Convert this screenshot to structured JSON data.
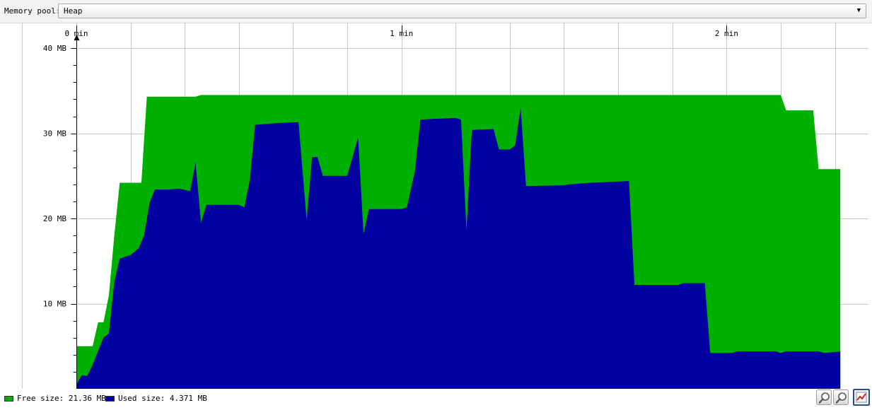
{
  "toolbar": {
    "pool_label": "Memory pool:",
    "pool_value": "Heap"
  },
  "colors": {
    "free": "#00b000",
    "used": "#0000a0"
  },
  "legend": {
    "free": "Free size: 21.36 MB",
    "used": "Used size: 4.371 MB"
  },
  "icons": [
    "zoom-in-icon",
    "zoom-out-icon",
    "chart-settings-icon"
  ],
  "chart_data": {
    "type": "area",
    "x_unit": "seconds",
    "x_ticks": [
      {
        "value": 0,
        "label": "0 min"
      },
      {
        "value": 60,
        "label": "1 min"
      },
      {
        "value": 120,
        "label": "2 min"
      }
    ],
    "y_ticks": [
      {
        "value": 10,
        "label": "10 MB"
      },
      {
        "value": 20,
        "label": "20 MB"
      },
      {
        "value": 30,
        "label": "30 MB"
      },
      {
        "value": 40,
        "label": "40 MB"
      }
    ],
    "xlim": [
      -14.1,
      146.2
    ],
    "ylim": [
      0,
      43
    ],
    "grid": true,
    "legend_position": "bottom-left",
    "series": [
      {
        "name": "Free size",
        "color_key": "free",
        "points": [
          [
            0,
            5
          ],
          [
            3,
            5
          ],
          [
            4,
            7.8
          ],
          [
            5,
            7.8
          ],
          [
            6,
            11
          ],
          [
            7,
            18
          ],
          [
            8,
            24.2
          ],
          [
            12,
            24.2
          ],
          [
            13,
            34.3
          ],
          [
            22,
            34.3
          ],
          [
            23,
            34.5
          ],
          [
            130,
            34.5
          ],
          [
            131,
            32.7
          ],
          [
            136,
            32.7
          ],
          [
            137,
            25.8
          ],
          [
            141,
            25.8
          ]
        ]
      },
      {
        "name": "Used size",
        "color_key": "used",
        "points": [
          [
            0,
            0.5
          ],
          [
            1,
            1.6
          ],
          [
            2,
            1.5
          ],
          [
            3,
            2.8
          ],
          [
            5,
            6
          ],
          [
            6,
            6.5
          ],
          [
            7,
            12.5
          ],
          [
            8,
            15.3
          ],
          [
            10,
            15.7
          ],
          [
            11.5,
            16.5
          ],
          [
            12.5,
            18
          ],
          [
            13.5,
            21.8
          ],
          [
            14.5,
            23.4
          ],
          [
            17,
            23.4
          ],
          [
            19,
            23.5
          ],
          [
            21,
            23.2
          ],
          [
            22,
            26.6
          ],
          [
            23,
            19.5
          ],
          [
            24,
            21.6
          ],
          [
            30,
            21.6
          ],
          [
            31,
            21.3
          ],
          [
            32,
            24.5
          ],
          [
            33,
            31
          ],
          [
            37,
            31.2
          ],
          [
            41,
            31.3
          ],
          [
            42.5,
            19.8
          ],
          [
            43.5,
            27.2
          ],
          [
            44.5,
            27.2
          ],
          [
            45.5,
            25
          ],
          [
            50,
            25
          ],
          [
            52,
            29.5
          ],
          [
            53,
            18.2
          ],
          [
            54,
            21.1
          ],
          [
            60,
            21.1
          ],
          [
            61,
            21.3
          ],
          [
            62.5,
            25.6
          ],
          [
            63.5,
            31.6
          ],
          [
            66,
            31.7
          ],
          [
            70,
            31.8
          ],
          [
            71,
            31.6
          ],
          [
            72,
            18.6
          ],
          [
            73,
            30.4
          ],
          [
            77,
            30.5
          ],
          [
            78,
            28.1
          ],
          [
            80,
            28.1
          ],
          [
            81,
            28.6
          ],
          [
            82,
            33
          ],
          [
            83,
            23.8
          ],
          [
            90,
            23.9
          ],
          [
            91,
            24
          ],
          [
            95,
            24.2
          ],
          [
            102,
            24.4
          ],
          [
            103,
            12.2
          ],
          [
            111,
            12.2
          ],
          [
            112,
            12.4
          ],
          [
            116,
            12.4
          ],
          [
            117,
            4.2
          ],
          [
            121,
            4.2
          ],
          [
            122,
            4.4
          ],
          [
            129,
            4.4
          ],
          [
            130,
            4.2
          ],
          [
            131,
            4.4
          ],
          [
            137,
            4.4
          ],
          [
            138,
            4.2
          ],
          [
            141,
            4.371
          ]
        ]
      }
    ]
  }
}
